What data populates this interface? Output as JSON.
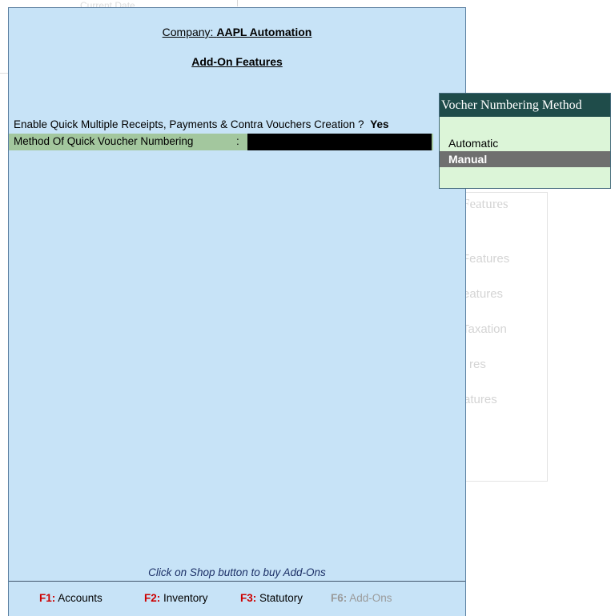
{
  "background": {
    "top_fragment": "Current Date",
    "panel_title": "Features",
    "panel_items": [
      "Features",
      "eatures",
      "Taxation",
      "res",
      "atures"
    ]
  },
  "header": {
    "company_label": "Company:",
    "company_name": "AAPL Automation",
    "screen_title": "Add-On Features"
  },
  "form": {
    "quick_multiple_label": "Enable Quick Multiple Receipts, Payments & Contra Vouchers Creation ?",
    "quick_multiple_value": "Yes",
    "numbering_label": "Method Of Quick Voucher Numbering",
    "numbering_colon": ":",
    "numbering_value": ""
  },
  "popup": {
    "title": "Vocher Numbering Method",
    "items": [
      "Automatic",
      "Manual"
    ],
    "selected": "Manual"
  },
  "footer": {
    "shop_note": "Click on Shop button to buy Add-Ons",
    "keys": [
      {
        "key": "F1:",
        "label": "Accounts"
      },
      {
        "key": "F2:",
        "label": "Inventory"
      },
      {
        "key": "F3:",
        "label": "Statutory"
      },
      {
        "key": "F6:",
        "label": "Add-Ons"
      }
    ]
  },
  "colors": {
    "panel_bg": "#c7e3f7",
    "highlight_row": "#a3c79e",
    "popup_bg": "#dcf5d8",
    "popup_title_bg": "#1f4c4a",
    "selected_item_bg": "#6f6f6f",
    "function_key": "#cc0000"
  }
}
